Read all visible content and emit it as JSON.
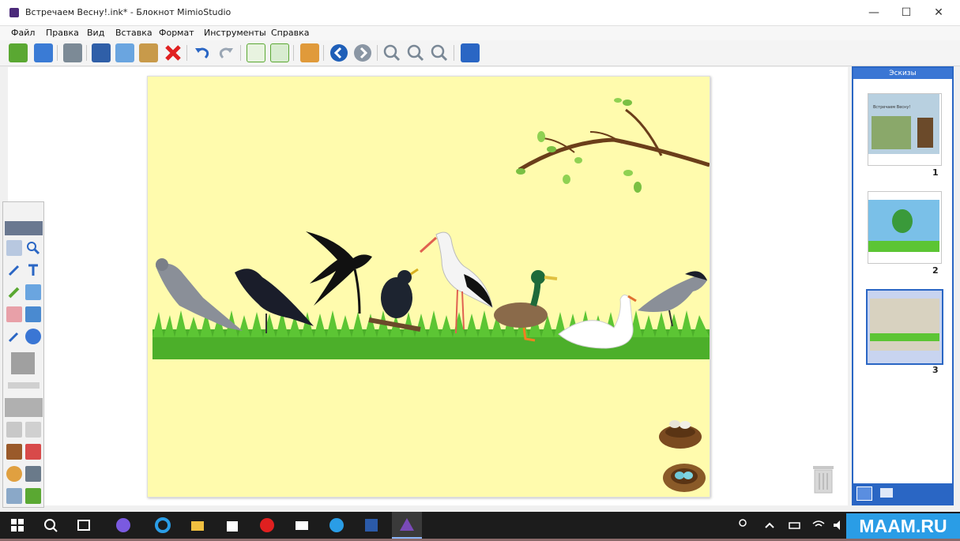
{
  "window": {
    "title": "Встречаем Весну!.ink* - Блокнот MimioStudio",
    "minimize": "—",
    "maximize": "☐",
    "close": "✕"
  },
  "menu": [
    "Файл",
    "Правка",
    "Вид",
    "Вставка",
    "Формат",
    "Инструменты",
    "Справка"
  ],
  "toolbar_icons": [
    "open-icon",
    "save-icon",
    "print-icon",
    "cut-icon",
    "copy-icon",
    "paste-icon",
    "delete-icon",
    "undo-icon",
    "redo-icon",
    "add-page-icon",
    "duplicate-page-icon",
    "users-icon",
    "prev-page-icon",
    "next-page-icon",
    "zoom-in-icon",
    "zoom-out-icon",
    "zoom-fit-icon",
    "fullscreen-icon"
  ],
  "panel": {
    "title": "Эскизы",
    "thumbnails": [
      {
        "number": "1",
        "caption": "Встречаем Весну!"
      },
      {
        "number": "2",
        "caption": ""
      },
      {
        "number": "3",
        "caption": ""
      }
    ]
  },
  "taskbar": {
    "watermark": "MAAM.RU"
  },
  "colors": {
    "page_bg": "#fffbad",
    "panel_accent": "#2a66c4",
    "grass": "#4caf2a",
    "watermark_bg": "#2a9de6"
  }
}
